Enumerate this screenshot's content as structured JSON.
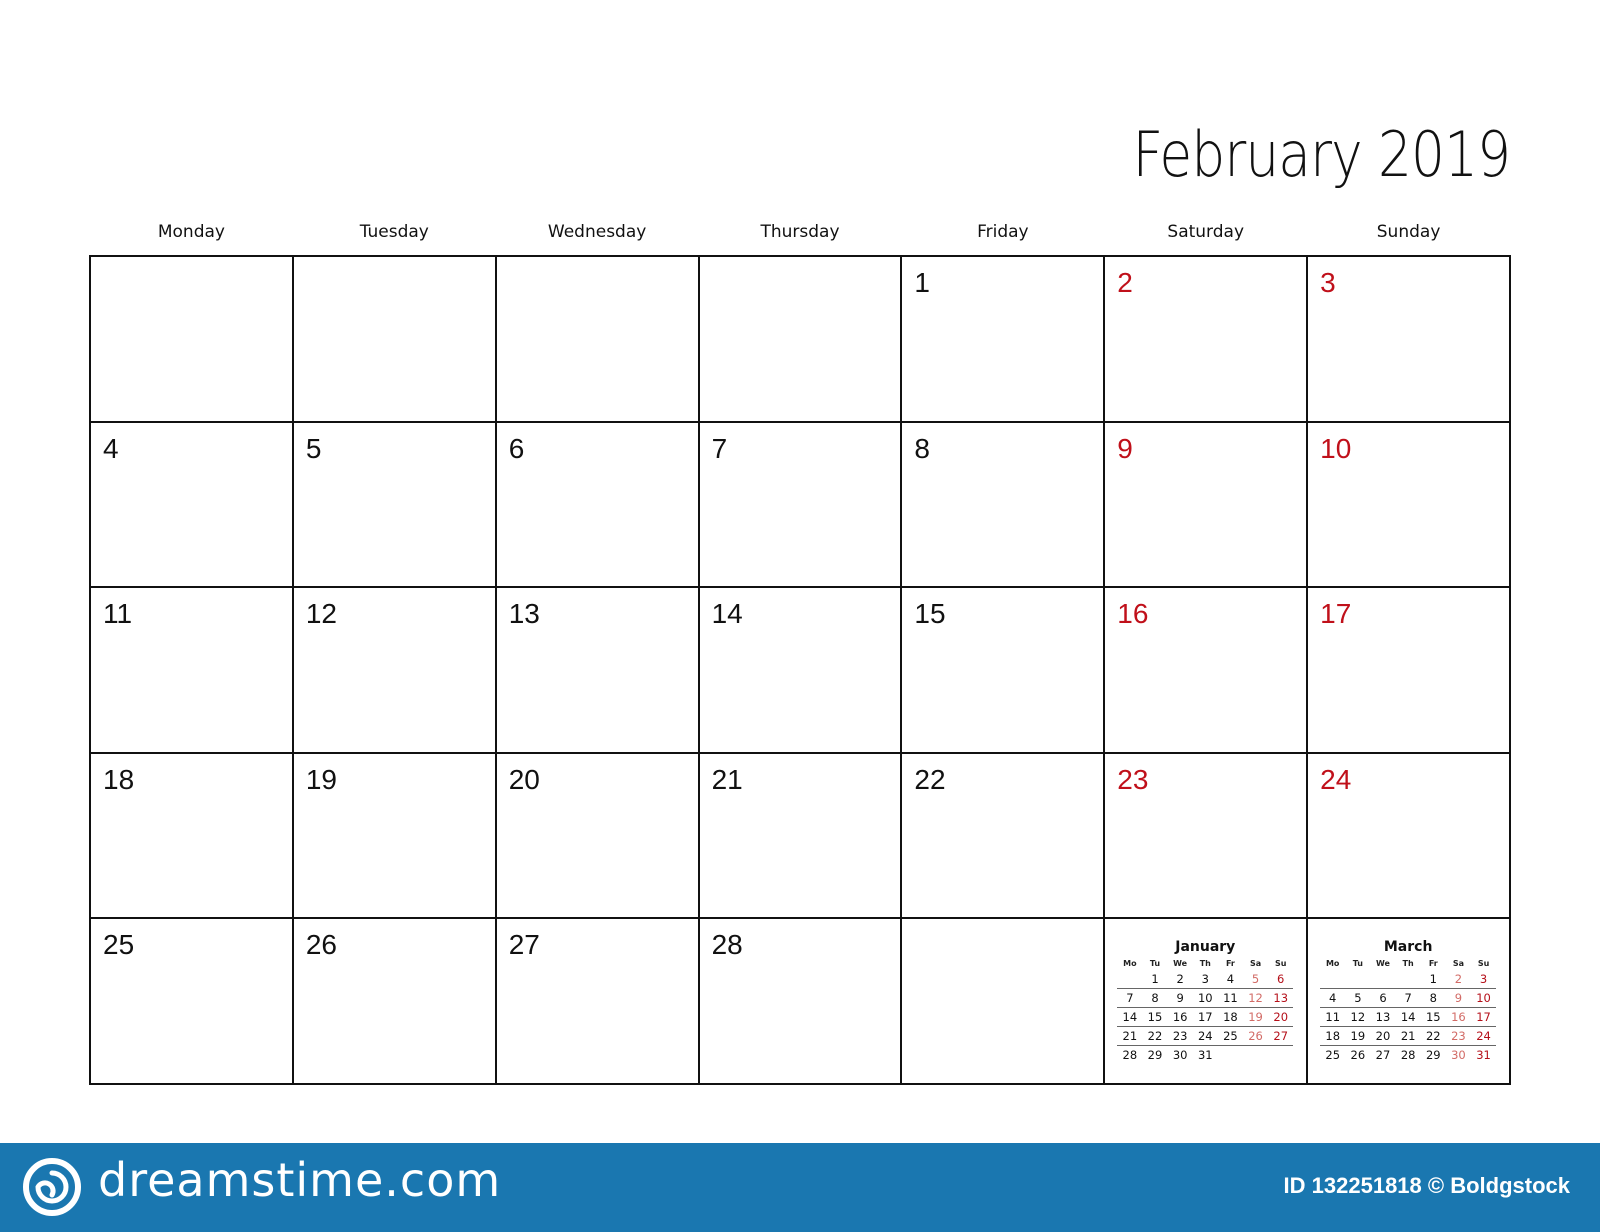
{
  "calendar": {
    "title": "February 2019",
    "weekdays": [
      "Monday",
      "Tuesday",
      "Wednesday",
      "Thursday",
      "Friday",
      "Saturday",
      "Sunday"
    ],
    "weekend_color": "#c0101a",
    "weeks": [
      [
        "",
        "",
        "",
        "",
        "1",
        "2",
        "3"
      ],
      [
        "4",
        "5",
        "6",
        "7",
        "8",
        "9",
        "10"
      ],
      [
        "11",
        "12",
        "13",
        "14",
        "15",
        "16",
        "17"
      ],
      [
        "18",
        "19",
        "20",
        "21",
        "22",
        "23",
        "24"
      ],
      [
        "25",
        "26",
        "27",
        "28",
        "",
        "",
        ""
      ]
    ]
  },
  "mini_calendars": {
    "headers": [
      "Mo",
      "Tu",
      "We",
      "Th",
      "Fr",
      "Sa",
      "Su"
    ],
    "previous": {
      "title": "January",
      "weeks": [
        [
          "",
          "1",
          "2",
          "3",
          "4",
          "5",
          "6"
        ],
        [
          "7",
          "8",
          "9",
          "10",
          "11",
          "12",
          "13"
        ],
        [
          "14",
          "15",
          "16",
          "17",
          "18",
          "19",
          "20"
        ],
        [
          "21",
          "22",
          "23",
          "24",
          "25",
          "26",
          "27"
        ],
        [
          "28",
          "29",
          "30",
          "31",
          "",
          "",
          ""
        ]
      ]
    },
    "next": {
      "title": "March",
      "weeks": [
        [
          "",
          "",
          "",
          "",
          "1",
          "2",
          "3"
        ],
        [
          "4",
          "5",
          "6",
          "7",
          "8",
          "9",
          "10"
        ],
        [
          "11",
          "12",
          "13",
          "14",
          "15",
          "16",
          "17"
        ],
        [
          "18",
          "19",
          "20",
          "21",
          "22",
          "23",
          "24"
        ],
        [
          "25",
          "26",
          "27",
          "28",
          "29",
          "30",
          "31"
        ]
      ]
    }
  },
  "footer": {
    "brand": "dreamstime.com",
    "brand_icon": "spiral-logo-icon",
    "credit": "ID 132251818 © Boldgstock",
    "background_color": "#1a77b0"
  }
}
